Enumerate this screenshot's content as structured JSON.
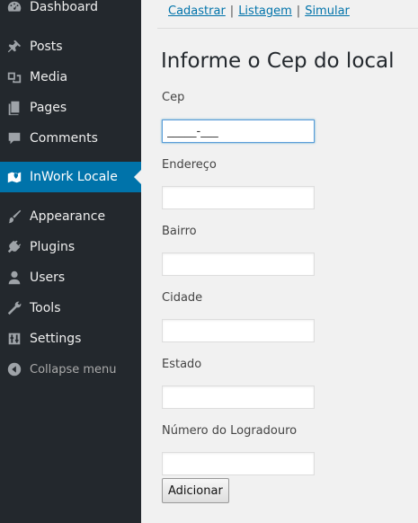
{
  "sidebar": {
    "items": [
      {
        "label": "Dashboard",
        "icon": "dashboard-icon"
      },
      {
        "label": "Posts",
        "icon": "pin-icon"
      },
      {
        "label": "Media",
        "icon": "media-icon"
      },
      {
        "label": "Pages",
        "icon": "pages-icon"
      },
      {
        "label": "Comments",
        "icon": "comment-icon"
      },
      {
        "label": "InWork Locale",
        "icon": "map-icon",
        "active": true
      },
      {
        "label": "Appearance",
        "icon": "brush-icon"
      },
      {
        "label": "Plugins",
        "icon": "plug-icon"
      },
      {
        "label": "Users",
        "icon": "user-icon"
      },
      {
        "label": "Tools",
        "icon": "wrench-icon"
      },
      {
        "label": "Settings",
        "icon": "settings-icon"
      }
    ],
    "collapse_label": "Collapse menu"
  },
  "subnav": {
    "links": [
      "Cadastrar",
      "Listagem",
      "Simular"
    ],
    "separator": "|"
  },
  "form": {
    "title": "Informe o Cep do local",
    "fields": [
      {
        "label": "Cep",
        "value": "_____-___"
      },
      {
        "label": "Endereço",
        "value": ""
      },
      {
        "label": "Bairro",
        "value": ""
      },
      {
        "label": "Cidade",
        "value": ""
      },
      {
        "label": "Estado",
        "value": ""
      },
      {
        "label": "Número do Logradouro",
        "value": ""
      }
    ],
    "submit_label": "Adicionar"
  },
  "colors": {
    "sidebar_bg": "#23282d",
    "active_bg": "#0073aa",
    "link": "#0073aa"
  }
}
